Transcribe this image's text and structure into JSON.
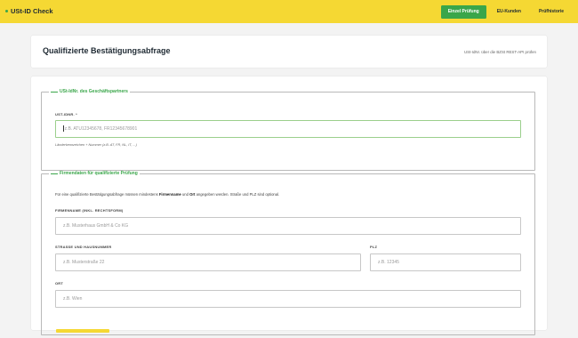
{
  "app": {
    "title": "USt-ID Check"
  },
  "nav": {
    "tabs": [
      {
        "label": "Einzel Prüfung",
        "active": true
      },
      {
        "label": "EU-Kunden",
        "active": false
      },
      {
        "label": "Prüfhistorie",
        "active": false
      }
    ]
  },
  "header": {
    "title": "Qualifizierte Bestätigungsabfrage",
    "subtitle": "USt-IdNr. über die BZSt REST-API prüfen"
  },
  "section_partner": {
    "legend": "USt-IdNr. des Geschäftspartners",
    "field_label": "UST-IDNR. *",
    "placeholder": "z.B. ATU12345678, FR12345678901",
    "hint": "Länderkennzeichen + Nummer (z.B. AT, FR, NL, IT, ...)"
  },
  "section_company": {
    "legend": "Firmendaten für qualifizierte Prüfung",
    "info_before": "Für eine qualifizierte Bestätigungsabfrage müssen mindestens",
    "info_bold1": "Firmenname",
    "info_mid": "und",
    "info_bold2": "Ort",
    "info_after": "angegeben werden. Straße und PLZ sind optional.",
    "company_label": "FIRMENNAME (INKL. RECHTSFORM)",
    "company_placeholder": "z.B. Musterhaus GmbH & Co KG",
    "street_label": "STRASSE UND HAUSNUMMER",
    "street_placeholder": "z.B. Musterstraße 22",
    "zip_label": "PLZ",
    "zip_placeholder": "z.B. 12345",
    "city_label": "ORT",
    "city_placeholder": "z.B. Wien"
  },
  "colors": {
    "topbar": "#f5d833",
    "accent_green": "#3aa64a"
  }
}
